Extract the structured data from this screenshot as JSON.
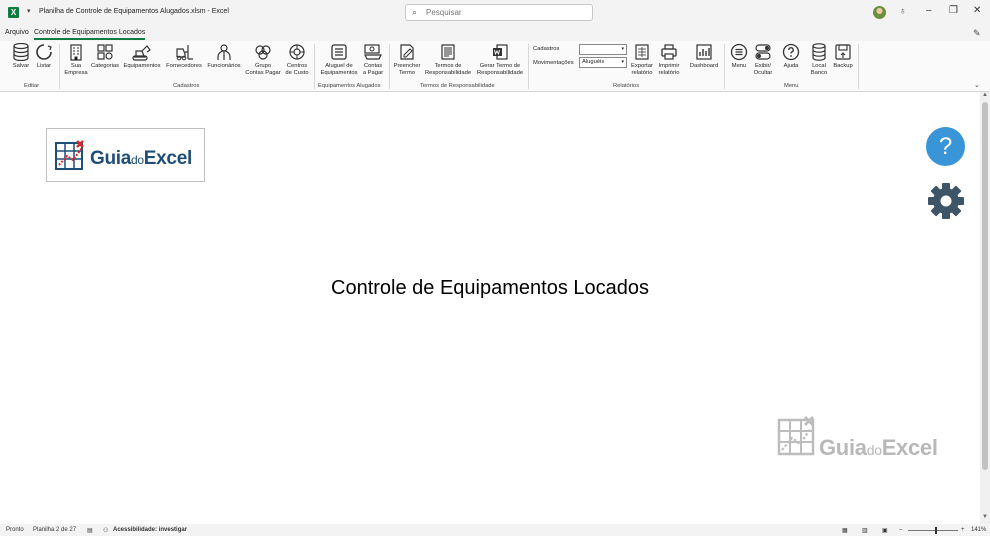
{
  "window": {
    "title": "Planilha de Controle de Equipamentos Alugados.xlsm  -  Excel",
    "app_icon": "X",
    "search_placeholder": "Pesquisar",
    "minimize": "–",
    "restore": "❐",
    "close": "✕"
  },
  "tabs": [
    {
      "label": "Arquivo"
    },
    {
      "label": "Controle de Equipamentos Locados",
      "active": true
    }
  ],
  "ribbon": {
    "buttons": {
      "salvar": "Salvar",
      "listar": "Listar",
      "sua_empresa_1": "Sua",
      "sua_empresa_2": "Empresa",
      "categorias": "Categorias",
      "equipamentos": "Equipamentos",
      "fornecedores": "Fornecedores",
      "funcionarios": "Funcionários",
      "grupo_1": "Grupo",
      "grupo_2": "Contas Pagar",
      "centros_1": "Centros",
      "centros_2": "de Custo",
      "aluguel_1": "Aluguel de",
      "aluguel_2": "Equipamentos",
      "contas_1": "Contas",
      "contas_2": "a Pagar",
      "preencher_1": "Preencher",
      "preencher_2": "Termo",
      "termos_1": "Termos de",
      "termos_2": "Responsabilidade",
      "gerar_1": "Gerar Termo de",
      "gerar_2": "Responsabilidade",
      "exportar_1": "Exportar",
      "exportar_2": "relatório",
      "imprimir_1": "Imprimir",
      "imprimir_2": "relatório",
      "dashboard": "Dashboard",
      "menu": "Menu",
      "exibir_1": "Exibir/",
      "exibir_2": "Ocultar",
      "ajuda": "Ajuda",
      "local_1": "Local",
      "local_2": "Banco",
      "backup": "Backup"
    },
    "fields": {
      "cadastros_label": "Cadastros",
      "cadastros_value": "",
      "movimentacoes_label": "Movimentações",
      "movimentacoes_value": "Aluguéis"
    },
    "groups": {
      "editar": "Editar",
      "cadastros": "Cadastros",
      "equipamentos_alugados": "Equipamentos Alugados",
      "termos": "Termos de Responsabilidade",
      "relatorios": "Relatórios",
      "menu": "Menu"
    }
  },
  "sheet": {
    "logo_main": "Guia",
    "logo_do": "do",
    "logo_excel": "Excel",
    "title": "Controle de Equipamentos Locados",
    "help_symbol": "?",
    "watermark_main": "Guia",
    "watermark_do": "do",
    "watermark_excel": "Excel"
  },
  "status": {
    "ready": "Pronto",
    "sheet_info": "Planilha 2 de 27",
    "accessibility": "Acessibilidade: investigar",
    "zoom_minus": "–",
    "zoom_plus": "+",
    "zoom_value": "141%"
  },
  "colors": {
    "excel_green": "#107c41",
    "help_blue": "#3a95d8",
    "gear_slate": "#3d5566",
    "logo_blue": "#1f4e79"
  }
}
